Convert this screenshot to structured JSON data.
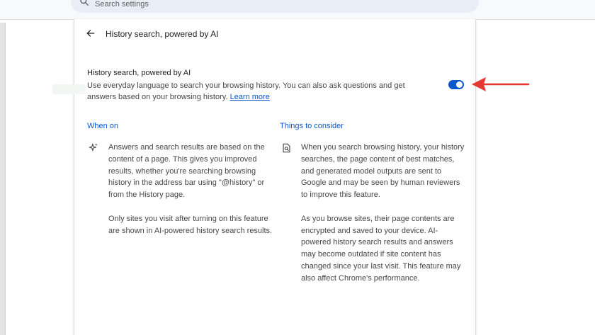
{
  "search": {
    "placeholder": "Search settings",
    "icon": "search-icon"
  },
  "header": {
    "back_icon": "arrow-left-icon",
    "title": "History search, powered by AI"
  },
  "setting": {
    "title": "History search, powered by AI",
    "description": "Use everyday language to search your browsing history. You can also ask questions and get answers based on your browsing history.",
    "learn_more": "Learn more",
    "toggle_state": "on",
    "toggle_color": "#0b57d0"
  },
  "when_on": {
    "heading": "When on",
    "icon": "sparkle-icon",
    "paragraphs": [
      "Answers and search results are based on the content of a page. This gives you improved results, whether you're searching browsing history in the address bar using \"@history\" or from the History page.",
      "Only sites you visit after turning on this feature are shown in AI-powered history search results."
    ]
  },
  "things_to_consider": {
    "heading": "Things to consider",
    "icon": "document-search-icon",
    "paragraphs": [
      "When you search browsing history, your history searches, the page content of best matches, and generated model outputs are sent to Google and may be seen by human reviewers to improve this feature.",
      "As you browse sites, their page contents are encrypted and saved to your device. AI-powered history search results and answers may become outdated if site content has changed since your last visit. This feature may also affect Chrome's performance."
    ]
  },
  "annotation": {
    "icon": "red-arrow-icon",
    "color": "#e53935"
  }
}
